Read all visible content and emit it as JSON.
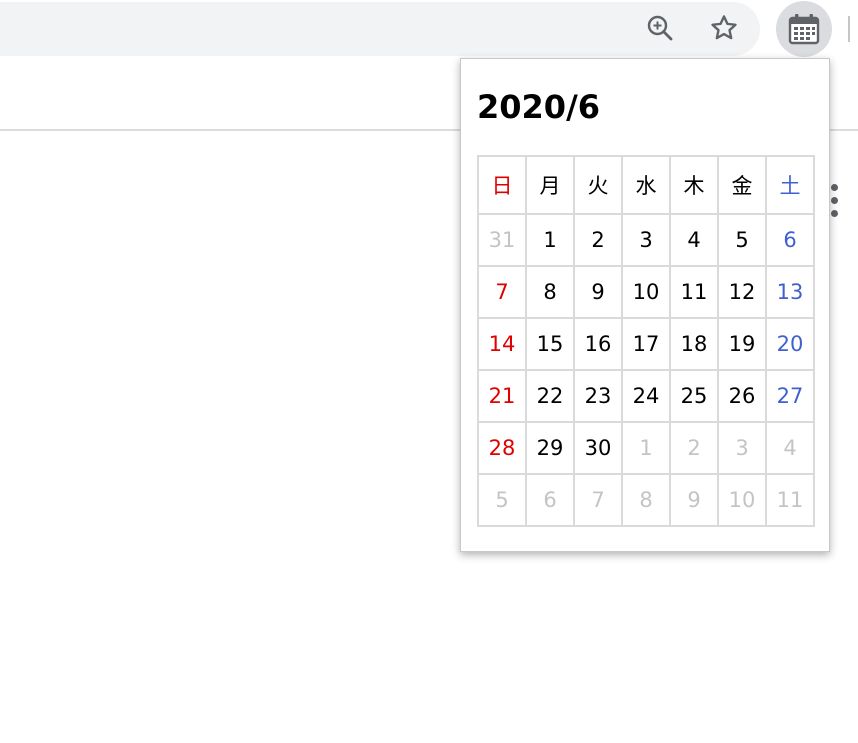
{
  "toolbar": {
    "icons": [
      "zoom-in-icon",
      "star-icon",
      "calendar-icon"
    ]
  },
  "calendar": {
    "title": "2020/6",
    "weekdays": [
      "日",
      "月",
      "火",
      "水",
      "木",
      "金",
      "土"
    ],
    "weeks": [
      [
        {
          "day": "31",
          "kind": "other"
        },
        {
          "day": "1",
          "kind": "weekday"
        },
        {
          "day": "2",
          "kind": "weekday"
        },
        {
          "day": "3",
          "kind": "weekday"
        },
        {
          "day": "4",
          "kind": "weekday"
        },
        {
          "day": "5",
          "kind": "weekday"
        },
        {
          "day": "6",
          "kind": "sat"
        }
      ],
      [
        {
          "day": "7",
          "kind": "sun"
        },
        {
          "day": "8",
          "kind": "weekday"
        },
        {
          "day": "9",
          "kind": "weekday"
        },
        {
          "day": "10",
          "kind": "weekday"
        },
        {
          "day": "11",
          "kind": "weekday"
        },
        {
          "day": "12",
          "kind": "weekday"
        },
        {
          "day": "13",
          "kind": "sat"
        }
      ],
      [
        {
          "day": "14",
          "kind": "sun"
        },
        {
          "day": "15",
          "kind": "weekday"
        },
        {
          "day": "16",
          "kind": "weekday"
        },
        {
          "day": "17",
          "kind": "weekday"
        },
        {
          "day": "18",
          "kind": "weekday"
        },
        {
          "day": "19",
          "kind": "weekday"
        },
        {
          "day": "20",
          "kind": "sat"
        }
      ],
      [
        {
          "day": "21",
          "kind": "sun"
        },
        {
          "day": "22",
          "kind": "weekday"
        },
        {
          "day": "23",
          "kind": "weekday"
        },
        {
          "day": "24",
          "kind": "weekday"
        },
        {
          "day": "25",
          "kind": "weekday"
        },
        {
          "day": "26",
          "kind": "weekday"
        },
        {
          "day": "27",
          "kind": "sat"
        }
      ],
      [
        {
          "day": "28",
          "kind": "sun"
        },
        {
          "day": "29",
          "kind": "weekday"
        },
        {
          "day": "30",
          "kind": "weekday"
        },
        {
          "day": "1",
          "kind": "other"
        },
        {
          "day": "2",
          "kind": "other"
        },
        {
          "day": "3",
          "kind": "other"
        },
        {
          "day": "4",
          "kind": "other"
        }
      ],
      [
        {
          "day": "5",
          "kind": "other"
        },
        {
          "day": "6",
          "kind": "other"
        },
        {
          "day": "7",
          "kind": "other"
        },
        {
          "day": "8",
          "kind": "other"
        },
        {
          "day": "9",
          "kind": "other"
        },
        {
          "day": "10",
          "kind": "other"
        },
        {
          "day": "11",
          "kind": "other"
        }
      ]
    ]
  },
  "colors": {
    "sunday": "#e00000",
    "saturday": "#4060d0",
    "other_month": "#c4c4c4",
    "weekday": "#000000",
    "grid": "#dadada"
  }
}
